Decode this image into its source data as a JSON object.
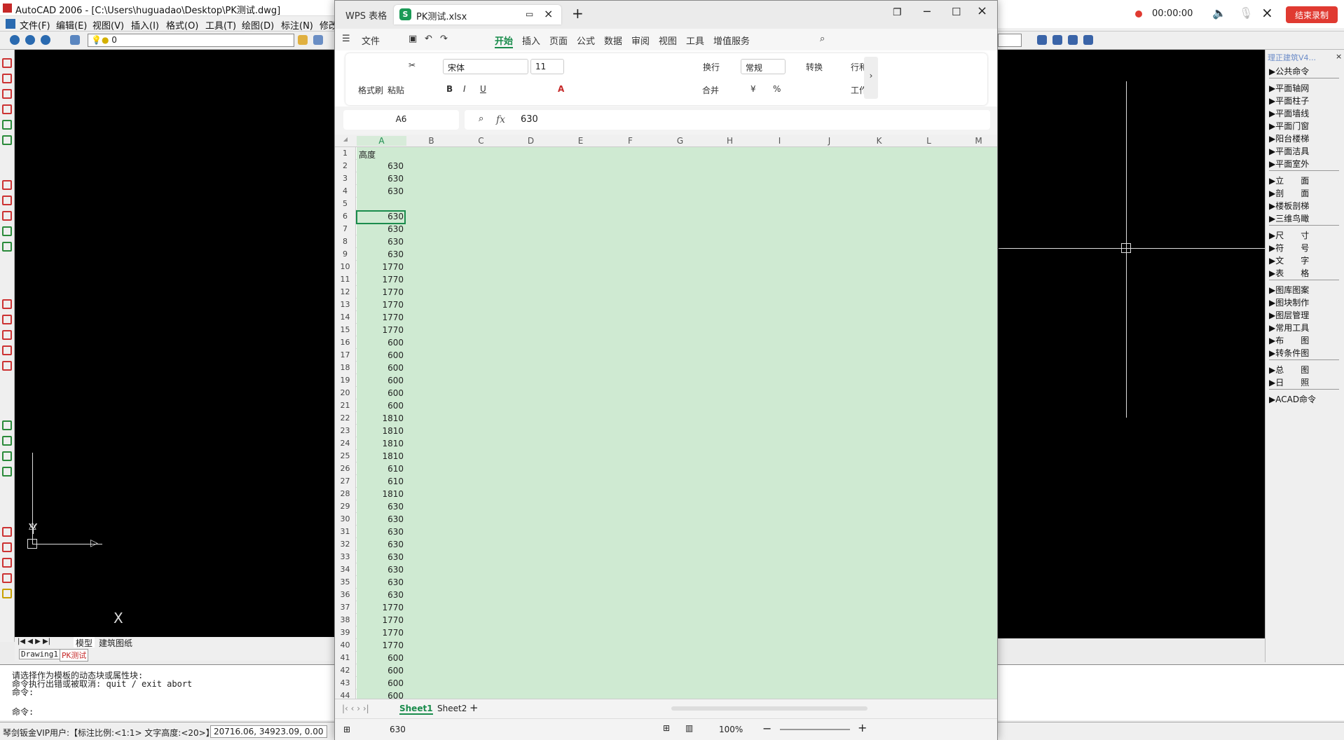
{
  "acad": {
    "title": "AutoCAD 2006 - [C:\\Users\\huguadao\\Desktop\\PK测试.dwg]",
    "menu": [
      "文件(F)",
      "编辑(E)",
      "视图(V)",
      "插入(I)",
      "格式(O)",
      "工具(T)",
      "绘图(D)",
      "标注(N)",
      "修改"
    ],
    "layer": "0",
    "model_tabs": [
      "模型",
      "建筑图纸"
    ],
    "drawing_tabs": [
      "Drawing1",
      "PK测试"
    ],
    "cmd_lines": [
      "请选择作为模板的动态块或属性块:",
      "命令执行出错或被取消: quit / exit abort",
      "命令:",
      "命令:"
    ],
    "status_user": "琴剑钣金VIP用户:【标注比例:<1:1> 文字高度:<20>】",
    "status_coords": "20716.06, 34923.09, 0.00",
    "axis_y": "Y",
    "axis_x": "X",
    "panel_title": "理正建筑V4...",
    "panel_items": [
      "公共命令",
      "平面轴网",
      "平面柱子",
      "平面墙线",
      "平面门窗",
      "阳台楼梯",
      "平面洁具",
      "平面室外",
      "立　　面",
      "剖　　面",
      "楼板剖梯",
      "三维鸟瞰",
      "尺　　寸",
      "符　　号",
      "文　　字",
      "表　　格",
      "图库图案",
      "图块制作",
      "图层管理",
      "常用工具",
      "布　　图",
      "转条件图",
      "总　　图",
      "日　　照",
      "ACAD命令"
    ]
  },
  "recorder": {
    "time": "00:00:00",
    "stop_label": "结束录制"
  },
  "wps": {
    "home_tab": "WPS 表格",
    "doc_tab": "PK测试.xlsx",
    "doc_icon": "S",
    "file_menu": "文件",
    "ribbon_tabs": [
      "开始",
      "插入",
      "页面",
      "公式",
      "数据",
      "审阅",
      "视图",
      "工具",
      "增值服务"
    ],
    "active_tab": "开始",
    "format_painter": "格式刷",
    "paste": "粘贴",
    "font": "宋体",
    "font_size": "11",
    "wrap": "换行",
    "number_format": "常规",
    "convert": "转换",
    "merge": "合并",
    "row_col": "行和",
    "worksheet": "工作",
    "name_box": "A6",
    "fx": "fx",
    "formula_value": "630",
    "columns": [
      "A",
      "B",
      "C",
      "D",
      "E",
      "F",
      "G",
      "H",
      "I",
      "J",
      "K",
      "L",
      "M"
    ],
    "cells": [
      "高度",
      "630",
      "630",
      "630",
      "",
      "630",
      "630",
      "630",
      "630",
      "1770",
      "1770",
      "1770",
      "1770",
      "1770",
      "1770",
      "600",
      "600",
      "600",
      "600",
      "600",
      "600",
      "1810",
      "1810",
      "1810",
      "1810",
      "610",
      "610",
      "1810",
      "630",
      "630",
      "630",
      "630",
      "630",
      "630",
      "630",
      "630",
      "1770",
      "1770",
      "1770",
      "1770",
      "600",
      "600",
      "600",
      "600"
    ],
    "sheets": [
      "Sheet1",
      "Sheet2"
    ],
    "active_sheet": "Sheet1",
    "status_value": "630",
    "zoom": "100%"
  }
}
